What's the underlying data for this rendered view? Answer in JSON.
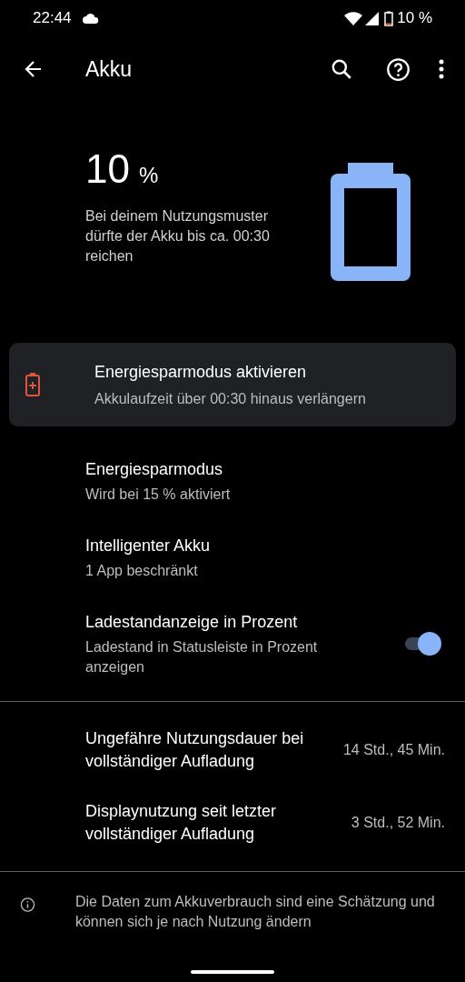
{
  "status_bar": {
    "time": "22:44",
    "battery": "10 %"
  },
  "toolbar": {
    "title": "Akku"
  },
  "summary": {
    "percent": "10",
    "unit": "%",
    "estimate": "Bei deinem Nutzungsmuster dürfte der Akku bis ca. 00:30 reichen"
  },
  "suggestion": {
    "title": "Energiesparmodus aktivieren",
    "summary": "Akkulaufzeit über 00:30 hinaus verlängern"
  },
  "items": [
    {
      "kind": "preference",
      "title": "Energiesparmodus",
      "summary": "Wird bei 15 % aktiviert"
    },
    {
      "kind": "preference",
      "title": "Intelligenter Akku",
      "summary": "1 App beschränkt"
    },
    {
      "kind": "switch",
      "title": "Ladestandanzeige in Prozent",
      "summary": "Ladestand in Statusleiste in Prozent anzeigen",
      "on": true
    }
  ],
  "stats": [
    {
      "title": "Ungefähre Nutzungsdauer bei vollständiger Aufladung",
      "value": "14 Std., 45 Min."
    },
    {
      "title": "Displaynutzung seit letzter vollständiger Aufladung",
      "value": "3 Std., 52 Min."
    }
  ],
  "footer": {
    "text": "Die Daten zum Akkuverbrauch sind eine Schätzung und können sich je nach Nutzung ändern"
  }
}
